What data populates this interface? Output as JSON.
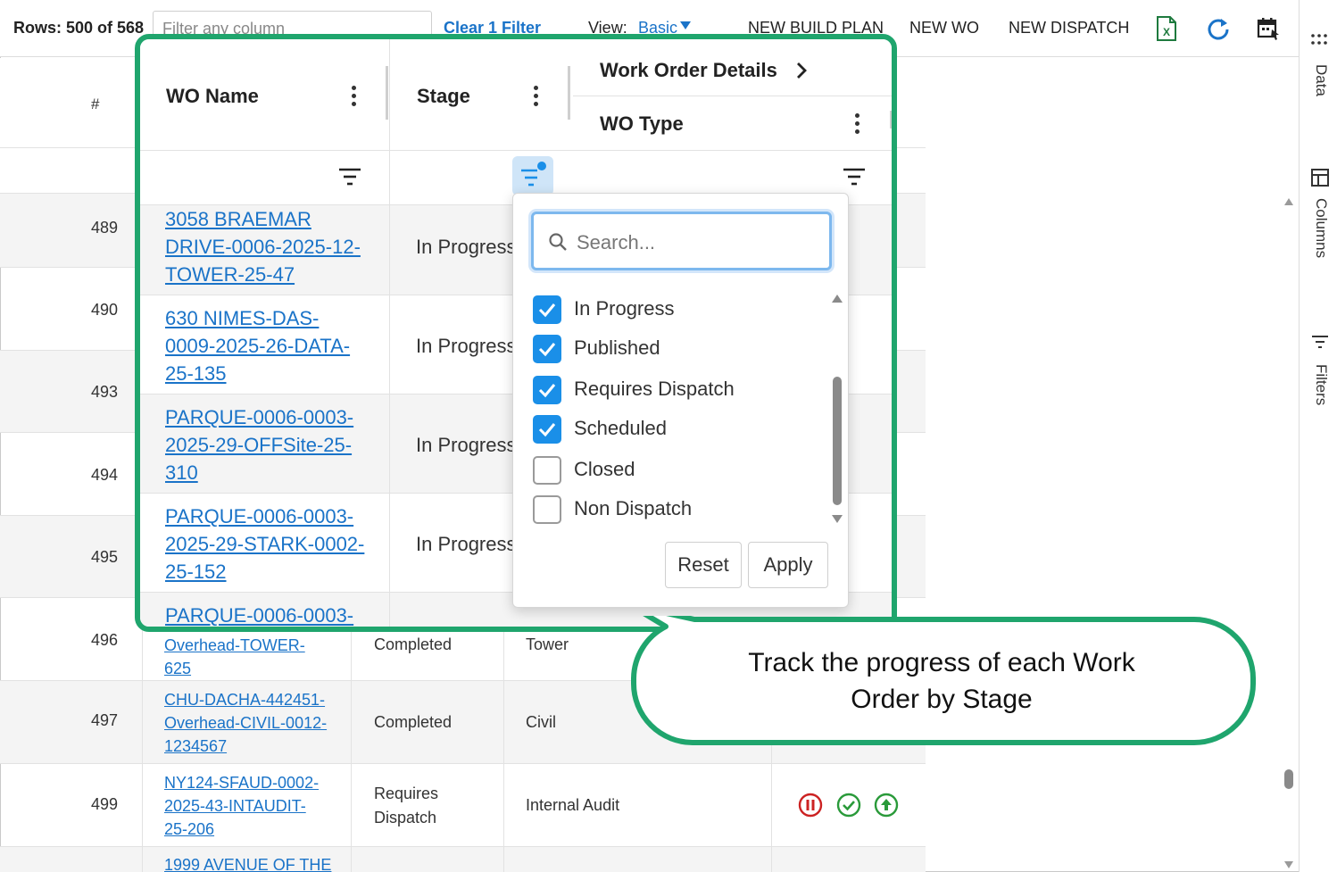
{
  "toolbar": {
    "rows_label": "Rows: 500 of 568",
    "filter_placeholder": "Filter any column",
    "clear_filter": "Clear 1 Filter",
    "view_label": "View:",
    "view_value": "Basic",
    "actions": [
      "NEW BUILD PLAN",
      "NEW WO",
      "NEW DISPATCH"
    ],
    "icons": [
      "excel-export-icon",
      "refresh-icon",
      "calendar-icon"
    ]
  },
  "side_panel": {
    "items": [
      "Data",
      "Columns",
      "Filters"
    ]
  },
  "grid": {
    "hash_header": "#",
    "rows": [
      {
        "num": "489",
        "name": "",
        "stage": "",
        "type": ""
      },
      {
        "num": "490",
        "name": "",
        "stage": "",
        "type": ""
      },
      {
        "num": "493",
        "name": "",
        "stage": "",
        "type": ""
      },
      {
        "num": "494",
        "name": "",
        "stage": "",
        "type": ""
      },
      {
        "num": "495",
        "name": "",
        "stage": "",
        "type": ""
      },
      {
        "num": "496",
        "name_lines": [
          "Overhead-TOWER-",
          "625"
        ],
        "stage": "Completed",
        "type": "Tower"
      },
      {
        "num": "497",
        "name_lines": [
          "CHU-DACHA-442451-",
          "Overhead-CIVIL-0012-",
          "1234567"
        ],
        "stage": "Completed",
        "type": "Civil"
      },
      {
        "num": "499",
        "name_lines": [
          "NY124-SFAUD-0002-",
          "2025-43-INTAUDIT-",
          "25-206"
        ],
        "stage_lines": [
          "Requires",
          "Dispatch"
        ],
        "type": "Internal Audit"
      },
      {
        "num": "",
        "name_lines": [
          "1999 AVENUE OF THE"
        ],
        "stage": "",
        "type": ""
      }
    ],
    "status_colors": {
      "pause": "#cc2222",
      "done": "#2a9a3a",
      "upload": "#2a9a3a"
    }
  },
  "zoom": {
    "columns": {
      "wo_name": "WO Name",
      "stage": "Stage",
      "group": "Work Order Details",
      "wo_type": "WO Type"
    },
    "rows": [
      {
        "name_lines": [
          "3058 BRAEMAR",
          "DRIVE-0006-2025-12-",
          "TOWER-25-47"
        ],
        "stage": "In Progress"
      },
      {
        "name_lines": [
          "630 NIMES-DAS-",
          "0009-2025-26-DATA-",
          "25-135"
        ],
        "stage": "In Progress"
      },
      {
        "name_lines": [
          "PARQUE-0006-0003-",
          "2025-29-OFFSite-25-",
          "310"
        ],
        "stage": "In Progress"
      },
      {
        "name_lines": [
          "PARQUE-0006-0003-",
          "2025-29-STARK-0002-",
          "25-152"
        ],
        "stage": "In Progress"
      },
      {
        "name_lines": [
          "PARQUE-0006-0003-"
        ],
        "stage": ""
      }
    ],
    "highlight_color": "#1fa56d"
  },
  "filter_dropdown": {
    "search_placeholder": "Search...",
    "options": [
      {
        "label": "In Progress",
        "checked": true
      },
      {
        "label": "Published",
        "checked": true
      },
      {
        "label": "Requires Dispatch",
        "checked": true
      },
      {
        "label": "Scheduled",
        "checked": true
      },
      {
        "label": "Closed",
        "checked": false
      },
      {
        "label": "Non Dispatch",
        "checked": false
      }
    ],
    "reset_label": "Reset",
    "apply_label": "Apply",
    "accent": "#1a8fe8"
  },
  "callout": {
    "line1": "Track the progress of each Work",
    "line2": "Order by Stage"
  }
}
